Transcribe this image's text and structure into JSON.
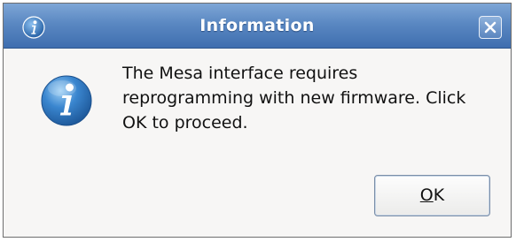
{
  "window": {
    "title": "Information",
    "title_icon": "info-icon",
    "close_icon": "close-icon"
  },
  "dialog": {
    "icon": "info-icon",
    "message_lines": [
      "The Mesa interface requires",
      "reprogramming with new firmware. Click",
      "OK to proceed."
    ]
  },
  "buttons": {
    "ok_mnemonic": "O",
    "ok_rest": "K"
  },
  "colors": {
    "titlebar": "#5a88c2",
    "icon_blue": "#2f72b8",
    "dialog_bg": "#f7f6f5"
  }
}
